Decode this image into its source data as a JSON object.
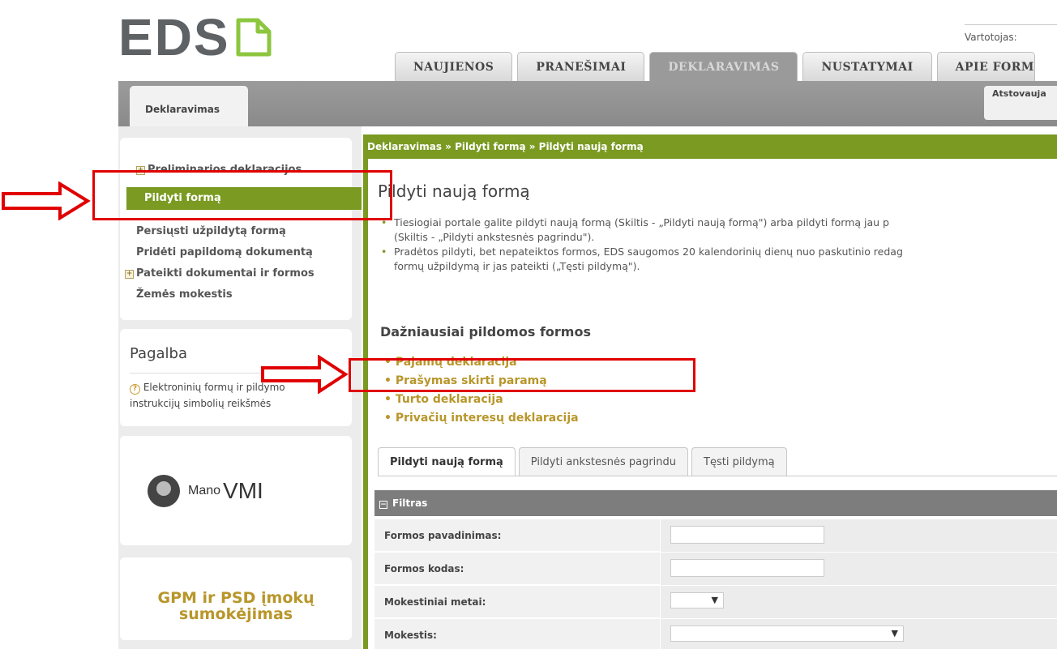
{
  "header": {
    "logo_text": "EDS",
    "user_label": "Vartotojas:",
    "nav_tabs": [
      "NAUJIENOS",
      "PRANEŠIMAI",
      "DEKLARAVIMAS",
      "NUSTATYMAI",
      "APIE FORM"
    ],
    "active_tab": "DEKLARAVIMAS",
    "subtab": "Deklaravimas",
    "represent_label": "Atstovauja"
  },
  "sidebar": {
    "nav": {
      "items": [
        {
          "label": "Preliminarios deklaracijos",
          "expandable": true
        },
        {
          "label": "Pildyti formą",
          "active": true
        },
        {
          "label": "Persiųsti užpildytą formą"
        },
        {
          "label": "Pridėti papildomą dokumentą"
        },
        {
          "label": "Pateikti dokumentai ir formos",
          "expandable": true
        },
        {
          "label": "Žemės mokestis"
        }
      ]
    },
    "help": {
      "title": "Pagalba",
      "text": "Elektroninių formų ir pildymo instrukcijų simbolių reikšmės"
    },
    "mano_vmi": {
      "small": "Mano",
      "big": "VMI"
    },
    "gpm": {
      "line1": "GPM ir PSD įmokų",
      "line2": "sumokėjimas"
    }
  },
  "main": {
    "breadcrumb": "Deklaravimas » Pildyti formą » Pildyti naują formą",
    "title": "Pildyti naują formą",
    "bullets": [
      [
        "Tiesiogiai portale galite pildyti naują formą (Skiltis - „Pildyti naują formą\") arba pildyti formą jau p",
        "(Skiltis - „Pildyti ankstesnės pagrindu\")."
      ],
      [
        "Pradėtos pildyti, bet nepateiktos formos, EDS saugomos 20 kalendorinių dienų nuo paskutinio redag",
        "formų užpildymą ir jas pateikti („Tęsti pildymą\")."
      ]
    ],
    "frequent_title": "Dažniausiai pildomos formos",
    "frequent_forms": [
      "Pajamų deklaracija",
      "Prašymas skirti paramą",
      "Turto deklaracija",
      "Privačių interesų deklaracija"
    ],
    "tabs": [
      "Pildyti naują formą",
      "Pildyti ankstesnės pagrindu",
      "Tęsti pildymą"
    ],
    "active_tab_index": 0,
    "filter": {
      "title": "Filtras",
      "rows": [
        {
          "label": "Formos pavadinimas:",
          "type": "input",
          "value": ""
        },
        {
          "label": "Formos kodas:",
          "type": "input",
          "value": ""
        },
        {
          "label": "Mokestiniai metai:",
          "type": "select",
          "value": ""
        },
        {
          "label": "Mokestis:",
          "type": "select",
          "value": ""
        }
      ]
    }
  },
  "colors": {
    "accent_green": "#7a9a22",
    "gold_link": "#b8962a",
    "annotation_red": "#e00000"
  }
}
